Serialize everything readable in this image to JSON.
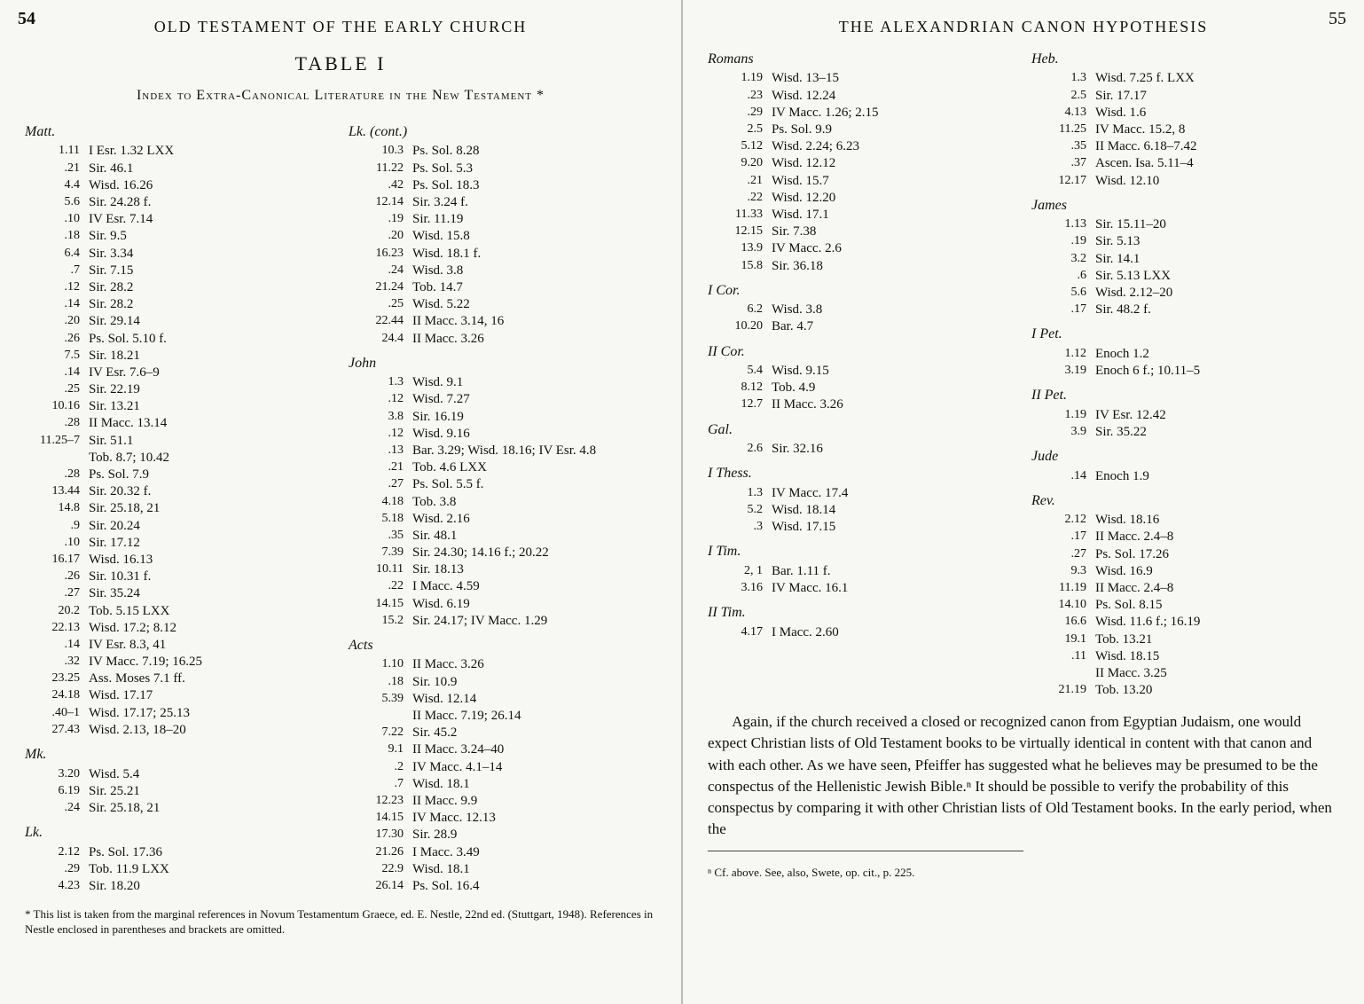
{
  "left": {
    "pageNum": "54",
    "runningHead": "OLD TESTAMENT OF THE EARLY CHURCH",
    "tableTitle": "TABLE I",
    "subhead": "Index to Extra-Canonical Literature in the New Testament *",
    "footnote": "* This list is taken from the marginal references in Novum Testamentum Graece, ed. E. Nestle, 22nd ed. (Stuttgart, 1948). References in Nestle enclosed in parentheses and brackets are omitted.",
    "col1": [
      {
        "book": "Matt."
      },
      {
        "v": "1.11",
        "r": "I Esr. 1.32 LXX"
      },
      {
        "v": ".21",
        "r": "Sir. 46.1"
      },
      {
        "v": "4.4",
        "r": "Wisd. 16.26"
      },
      {
        "v": "5.6",
        "r": "Sir. 24.28 f."
      },
      {
        "v": ".10",
        "r": "IV Esr. 7.14"
      },
      {
        "v": ".18",
        "r": "Sir. 9.5"
      },
      {
        "v": "6.4",
        "r": "Sir. 3.34"
      },
      {
        "v": ".7",
        "r": "Sir. 7.15"
      },
      {
        "v": ".12",
        "r": "Sir. 28.2"
      },
      {
        "v": ".14",
        "r": "Sir. 28.2"
      },
      {
        "v": ".20",
        "r": "Sir. 29.14"
      },
      {
        "v": ".26",
        "r": "Ps. Sol. 5.10 f."
      },
      {
        "v": "7.5",
        "r": "Sir. 18.21"
      },
      {
        "v": ".14",
        "r": "IV Esr. 7.6–9"
      },
      {
        "v": ".25",
        "r": "Sir. 22.19"
      },
      {
        "v": "10.16",
        "r": "Sir. 13.21"
      },
      {
        "v": ".28",
        "r": "II Macc. 13.14"
      },
      {
        "v": "11.25–7",
        "r": "Sir. 51.1"
      },
      {
        "v": "",
        "r": "Tob. 8.7; 10.42"
      },
      {
        "v": ".28",
        "r": "Ps. Sol. 7.9"
      },
      {
        "v": "13.44",
        "r": "Sir. 20.32 f."
      },
      {
        "v": "14.8",
        "r": "Sir. 25.18, 21"
      },
      {
        "v": ".9",
        "r": "Sir. 20.24"
      },
      {
        "v": ".10",
        "r": "Sir. 17.12"
      },
      {
        "v": "16.17",
        "r": "Wisd. 16.13"
      },
      {
        "v": ".26",
        "r": "Sir. 10.31 f."
      },
      {
        "v": ".27",
        "r": "Sir. 35.24"
      },
      {
        "v": "20.2",
        "r": "Tob. 5.15 LXX"
      },
      {
        "v": "22.13",
        "r": "Wisd. 17.2; 8.12"
      },
      {
        "v": ".14",
        "r": "IV Esr. 8.3, 41"
      },
      {
        "v": ".32",
        "r": "IV Macc. 7.19; 16.25"
      },
      {
        "v": "23.25",
        "r": "Ass. Moses 7.1 ff."
      },
      {
        "v": "24.18",
        "r": "Wisd. 17.17"
      },
      {
        "v": ".40–1",
        "r": "Wisd. 17.17; 25.13"
      },
      {
        "v": "27.43",
        "r": "Wisd. 2.13, 18–20"
      },
      {
        "book": "Mk."
      },
      {
        "v": "3.20",
        "r": "Wisd. 5.4"
      },
      {
        "v": "6.19",
        "r": "Sir. 25.21"
      },
      {
        "v": ".24",
        "r": "Sir. 25.18, 21"
      },
      {
        "book": "Lk."
      },
      {
        "v": "2.12",
        "r": "Ps. Sol. 17.36"
      },
      {
        "v": ".29",
        "r": "Tob. 11.9 LXX"
      },
      {
        "v": "4.23",
        "r": "Sir. 18.20"
      }
    ],
    "col2": [
      {
        "book": "Lk. (cont.)"
      },
      {
        "v": "10.3",
        "r": "Ps. Sol. 8.28"
      },
      {
        "v": "11.22",
        "r": "Ps. Sol. 5.3"
      },
      {
        "v": ".42",
        "r": "Ps. Sol. 18.3"
      },
      {
        "v": "12.14",
        "r": "Sir. 3.24 f."
      },
      {
        "v": ".19",
        "r": "Sir. 11.19"
      },
      {
        "v": ".20",
        "r": "Wisd. 15.8"
      },
      {
        "v": "16.23",
        "r": "Wisd. 18.1 f."
      },
      {
        "v": ".24",
        "r": "Wisd. 3.8"
      },
      {
        "v": "21.24",
        "r": "Tob. 14.7"
      },
      {
        "v": ".25",
        "r": "Wisd. 5.22"
      },
      {
        "v": "22.44",
        "r": "II Macc. 3.14, 16"
      },
      {
        "v": "24.4",
        "r": "II Macc. 3.26"
      },
      {
        "book": "John"
      },
      {
        "v": "1.3",
        "r": "Wisd. 9.1"
      },
      {
        "v": ".12",
        "r": "Wisd. 7.27"
      },
      {
        "v": "3.8",
        "r": "Sir. 16.19"
      },
      {
        "v": ".12",
        "r": "Wisd. 9.16"
      },
      {
        "v": ".13",
        "r": "Bar. 3.29; Wisd. 18.16; IV Esr. 4.8"
      },
      {
        "v": ".21",
        "r": "Tob. 4.6 LXX"
      },
      {
        "v": ".27",
        "r": "Ps. Sol. 5.5 f."
      },
      {
        "v": "4.18",
        "r": "Tob. 3.8"
      },
      {
        "v": "5.18",
        "r": "Wisd. 2.16"
      },
      {
        "v": ".35",
        "r": "Sir. 48.1"
      },
      {
        "v": "7.39",
        "r": "Sir. 24.30; 14.16 f.; 20.22"
      },
      {
        "v": "10.11",
        "r": "Sir. 18.13"
      },
      {
        "v": ".22",
        "r": "I Macc. 4.59"
      },
      {
        "v": "14.15",
        "r": "Wisd. 6.19"
      },
      {
        "v": "15.2",
        "r": "Sir. 24.17; IV Macc. 1.29"
      },
      {
        "book": "Acts"
      },
      {
        "v": "1.10",
        "r": "II Macc. 3.26"
      },
      {
        "v": ".18",
        "r": "Sir. 10.9"
      },
      {
        "v": "5.39",
        "r": "Wisd. 12.14"
      },
      {
        "v": "",
        "r": "II Macc. 7.19; 26.14"
      },
      {
        "v": "7.22",
        "r": "Sir. 45.2"
      },
      {
        "v": "9.1",
        "r": "II Macc. 3.24–40"
      },
      {
        "v": ".2",
        "r": "IV Macc. 4.1–14"
      },
      {
        "v": ".7",
        "r": "Wisd. 18.1"
      },
      {
        "v": "12.23",
        "r": "II Macc. 9.9"
      },
      {
        "v": "14.15",
        "r": "IV Macc. 12.13"
      },
      {
        "v": "17.30",
        "r": "Sir. 28.9"
      },
      {
        "v": "21.26",
        "r": "I Macc. 3.49"
      },
      {
        "v": "22.9",
        "r": "Wisd. 18.1"
      },
      {
        "v": "26.14",
        "r": "Ps. Sol. 16.4"
      }
    ]
  },
  "right": {
    "pageNum": "55",
    "runningHead": "THE ALEXANDRIAN CANON HYPOTHESIS",
    "col1": [
      {
        "book": "Romans"
      },
      {
        "v": "1.19",
        "r": "Wisd. 13–15"
      },
      {
        "v": ".23",
        "r": "Wisd. 12.24"
      },
      {
        "v": ".29",
        "r": "IV Macc. 1.26; 2.15"
      },
      {
        "v": "2.5",
        "r": "Ps. Sol. 9.9"
      },
      {
        "v": "5.12",
        "r": "Wisd. 2.24; 6.23"
      },
      {
        "v": "9.20",
        "r": "Wisd. 12.12"
      },
      {
        "v": ".21",
        "r": "Wisd. 15.7"
      },
      {
        "v": ".22",
        "r": "Wisd. 12.20"
      },
      {
        "v": "11.33",
        "r": "Wisd. 17.1"
      },
      {
        "v": "12.15",
        "r": "Sir. 7.38"
      },
      {
        "v": "13.9",
        "r": "IV Macc. 2.6"
      },
      {
        "v": "15.8",
        "r": "Sir. 36.18"
      },
      {
        "book": "I Cor."
      },
      {
        "v": "6.2",
        "r": "Wisd. 3.8"
      },
      {
        "v": "10.20",
        "r": "Bar. 4.7"
      },
      {
        "book": "II Cor."
      },
      {
        "v": "5.4",
        "r": "Wisd. 9.15"
      },
      {
        "v": "8.12",
        "r": "Tob. 4.9"
      },
      {
        "v": "12.7",
        "r": "II Macc. 3.26"
      },
      {
        "book": "Gal."
      },
      {
        "v": "2.6",
        "r": "Sir. 32.16"
      },
      {
        "book": "I Thess."
      },
      {
        "v": "1.3",
        "r": "IV Macc. 17.4"
      },
      {
        "v": "5.2",
        "r": "Wisd. 18.14"
      },
      {
        "v": ".3",
        "r": "Wisd. 17.15"
      },
      {
        "book": "I Tim."
      },
      {
        "v": "2, 1",
        "r": "Bar. 1.11 f."
      },
      {
        "v": "3.16",
        "r": "IV Macc. 16.1"
      },
      {
        "book": "II Tim."
      },
      {
        "v": "4.17",
        "r": "I Macc. 2.60"
      }
    ],
    "col2": [
      {
        "book": "Heb."
      },
      {
        "v": "1.3",
        "r": "Wisd. 7.25 f. LXX"
      },
      {
        "v": "2.5",
        "r": "Sir. 17.17"
      },
      {
        "v": "4.13",
        "r": "Wisd. 1.6"
      },
      {
        "v": "11.25",
        "r": "IV Macc. 15.2, 8"
      },
      {
        "v": ".35",
        "r": "II Macc. 6.18–7.42"
      },
      {
        "v": ".37",
        "r": "Ascen. Isa. 5.11–4"
      },
      {
        "v": "12.17",
        "r": "Wisd. 12.10"
      },
      {
        "book": "James"
      },
      {
        "v": "1.13",
        "r": "Sir. 15.11–20"
      },
      {
        "v": ".19",
        "r": "Sir. 5.13"
      },
      {
        "v": "3.2",
        "r": "Sir. 14.1"
      },
      {
        "v": ".6",
        "r": "Sir. 5.13 LXX"
      },
      {
        "v": "5.6",
        "r": "Wisd. 2.12–20"
      },
      {
        "v": ".17",
        "r": "Sir. 48.2 f."
      },
      {
        "book": "I Pet."
      },
      {
        "v": "1.12",
        "r": "Enoch 1.2"
      },
      {
        "v": "3.19",
        "r": "Enoch 6 f.; 10.11–5"
      },
      {
        "book": "II Pet."
      },
      {
        "v": "1.19",
        "r": "IV Esr. 12.42"
      },
      {
        "v": "3.9",
        "r": "Sir. 35.22"
      },
      {
        "book": "Jude"
      },
      {
        "v": ".14",
        "r": "Enoch 1.9"
      },
      {
        "book": "Rev."
      },
      {
        "v": "2.12",
        "r": "Wisd. 18.16"
      },
      {
        "v": ".17",
        "r": "II Macc. 2.4–8"
      },
      {
        "v": ".27",
        "r": "Ps. Sol. 17.26"
      },
      {
        "v": "9.3",
        "r": "Wisd. 16.9"
      },
      {
        "v": "11.19",
        "r": "II Macc. 2.4–8"
      },
      {
        "v": "14.10",
        "r": "Ps. Sol. 8.15"
      },
      {
        "v": "16.6",
        "r": "Wisd. 11.6 f.; 16.19"
      },
      {
        "v": "19.1",
        "r": "Tob. 13.21"
      },
      {
        "v": ".11",
        "r": "Wisd. 18.15"
      },
      {
        "v": "",
        "r": "II Macc. 3.25"
      },
      {
        "v": "21.19",
        "r": "Tob. 13.20"
      }
    ],
    "paragraph": "Again, if the church received a closed or recognized canon from Egyptian Judaism, one would expect Christian lists of Old Testament books to be virtually identical in content with that canon and with each other. As we have seen, Pfeiffer has suggested what he believes may be presumed to be the conspectus of the Hellenistic Jewish Bible.ⁿ It should be possible to verify the probability of this conspectus by comparing it with other Christian lists of Old Testament books. In the early period, when the",
    "smallNote": "ⁿ Cf. above. See, also, Swete, op. cit., p. 225."
  }
}
